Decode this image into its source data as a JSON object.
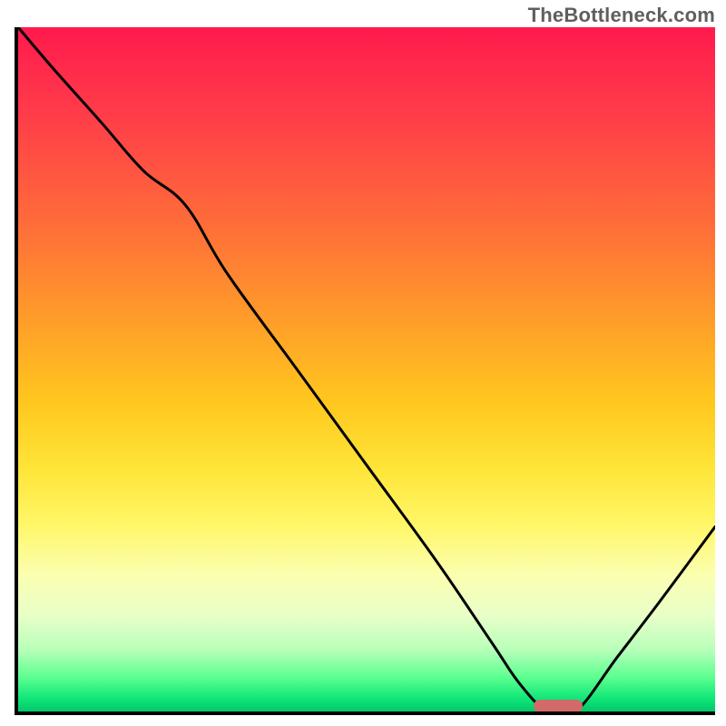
{
  "watermark": "TheBottleneck.com",
  "colors": {
    "gradient_top": "#ff1a4d",
    "gradient_mid": "#ffe63a",
    "gradient_bottom": "#00c96b",
    "curve": "#000000",
    "axes": "#000000",
    "marker": "#d36a6a"
  },
  "chart_data": {
    "type": "line",
    "title": "",
    "xlabel": "",
    "ylabel": "",
    "xlim": [
      0,
      100
    ],
    "ylim": [
      0,
      100
    ],
    "x": [
      0,
      5,
      12,
      18,
      24,
      30,
      40,
      50,
      60,
      68,
      72,
      76,
      80,
      86,
      92,
      100
    ],
    "values": [
      100,
      94,
      86,
      79,
      74,
      64,
      50,
      36,
      22,
      10,
      4,
      0,
      0,
      8,
      16,
      27
    ],
    "marker": {
      "x_start": 74,
      "x_end": 81,
      "y": 0
    },
    "note": "Values are estimated from pixel positions; x and y are normalized 0–100. y=100 is the top of the plot, y=0 is the bottom axis."
  }
}
